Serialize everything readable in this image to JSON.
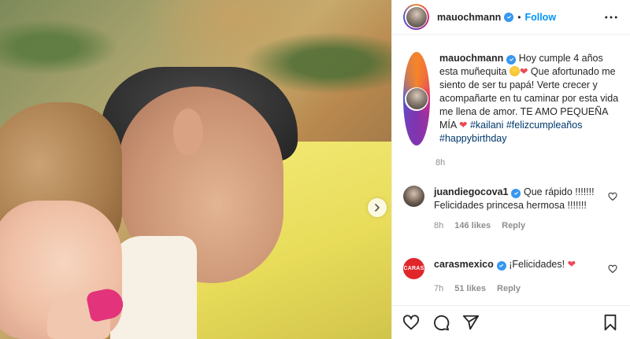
{
  "post": {
    "author": "mauochmann",
    "follow_label": "Follow",
    "separator": "•",
    "caption": {
      "author": "mauochmann",
      "text_part1": "Hoy cumple 4 años esta muñequita ",
      "text_part2": " Que afortunado me siento de ser tu papá! Verte crecer y acompañarte en tu caminar por esta vida me llena de amor. TE AMO PEQUEÑA MÍA ",
      "heart": "❤",
      "hashtags": [
        "#kailani",
        "#felizcumpleaños",
        "#happybirthday"
      ],
      "time": "8h"
    },
    "comments": [
      {
        "username": "juandiegocova1",
        "text": "Que rápido !!!!!!! Felicidades princesa hermosa !!!!!!!",
        "time": "8h",
        "likes": "146 likes",
        "reply_label": "Reply"
      },
      {
        "username": "carasmexico",
        "avatar_text": "CARAS",
        "text": "¡Felicidades! ",
        "heart": "❤",
        "time": "7h",
        "likes": "51 likes",
        "reply_label": "Reply"
      }
    ]
  },
  "icons": {
    "verified": "verified-badge-icon",
    "more": "more-options-icon",
    "carousel": "chevron-right-icon",
    "like": "heart-icon",
    "comment": "comment-icon",
    "share": "share-icon",
    "save": "bookmark-icon"
  },
  "colors": {
    "accent": "#0095f6",
    "verified": "#3897f0",
    "heart": "#ed4956",
    "hashtag": "#00376b",
    "muted": "#8e8e8e"
  }
}
